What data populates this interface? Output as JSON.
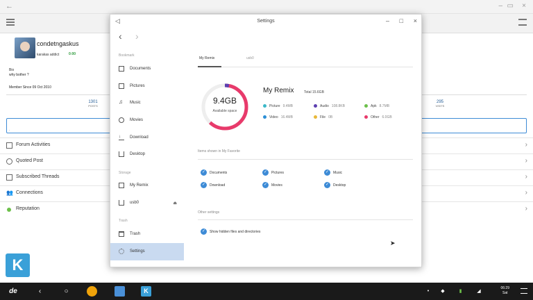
{
  "background_app": {
    "username": "condetngaskus",
    "user_title": "karakas addict",
    "online_status": "0:00",
    "bio_label": "Bio",
    "bio_text": "why bother ?",
    "member_since": "Member Since 09 Oct 2010",
    "stats": [
      {
        "value": "1301",
        "label": "POSTS"
      },
      {
        "value": "295",
        "label": "VISITS"
      }
    ],
    "menu_rows": [
      {
        "label": "Forum Activities",
        "icon": "square-icon"
      },
      {
        "label": "Quoted Post",
        "icon": "quote-icon"
      },
      {
        "label": "Subscribed Threads",
        "icon": "threads-icon"
      },
      {
        "label": "Connections",
        "icon": "people-icon"
      },
      {
        "label": "Reputation",
        "icon": "green-dot-icon"
      }
    ],
    "logo_letter": "K",
    "brand_color": "#3aa0d8"
  },
  "taskbar": {
    "start_label": "de",
    "clock_time": "06:29",
    "clock_day": "Sat"
  },
  "dialog": {
    "title": "Settings",
    "sidebar": {
      "sections": [
        {
          "label": "Bookmark",
          "items": [
            {
              "label": "Documents",
              "icon": "documents-icon"
            },
            {
              "label": "Pictures",
              "icon": "pictures-icon"
            },
            {
              "label": "Music",
              "icon": "music-icon"
            },
            {
              "label": "Movies",
              "icon": "movies-icon"
            },
            {
              "label": "Download",
              "icon": "download-icon"
            },
            {
              "label": "Desktop",
              "icon": "desktop-icon"
            }
          ]
        },
        {
          "label": "Storage",
          "items": [
            {
              "label": "My Remix",
              "icon": "drive-icon"
            },
            {
              "label": "usb0",
              "icon": "usb-icon"
            }
          ]
        },
        {
          "label": "Trash",
          "items": [
            {
              "label": "Trash",
              "icon": "trash-icon"
            },
            {
              "label": "Settings",
              "icon": "settings-icon",
              "active": true
            }
          ]
        }
      ]
    },
    "tabs": [
      {
        "label": "My Remix",
        "active": true
      },
      {
        "label": "usb0",
        "active": false
      }
    ],
    "storage": {
      "used": "9.4GB",
      "used_label": "Available space",
      "title": "My Remix",
      "total": "Total 15.6GB",
      "used_fraction": 0.62,
      "legend": [
        {
          "name": "Picture",
          "size": "9.4MB",
          "color": "#3bb8c8"
        },
        {
          "name": "Audio",
          "size": "108.8KB",
          "color": "#5c3fb0"
        },
        {
          "name": "Apk",
          "size": "8.7MB",
          "color": "#6cc04a"
        },
        {
          "name": "Video",
          "size": "16.4MB",
          "color": "#2c8fd6"
        },
        {
          "name": "File",
          "size": "0B",
          "color": "#e8b83a"
        },
        {
          "name": "Other",
          "size": "6.0GB",
          "color": "#e83a6b"
        }
      ]
    },
    "favorites": {
      "label": "Items shown in My Favorite",
      "items": [
        "Documents",
        "Pictures",
        "Music",
        "Download",
        "Movies",
        "Desktop"
      ]
    },
    "other_settings": {
      "label": "Other settings",
      "items": [
        "Show hidden files and directories"
      ]
    },
    "accent_color": "#3d8bd6"
  }
}
